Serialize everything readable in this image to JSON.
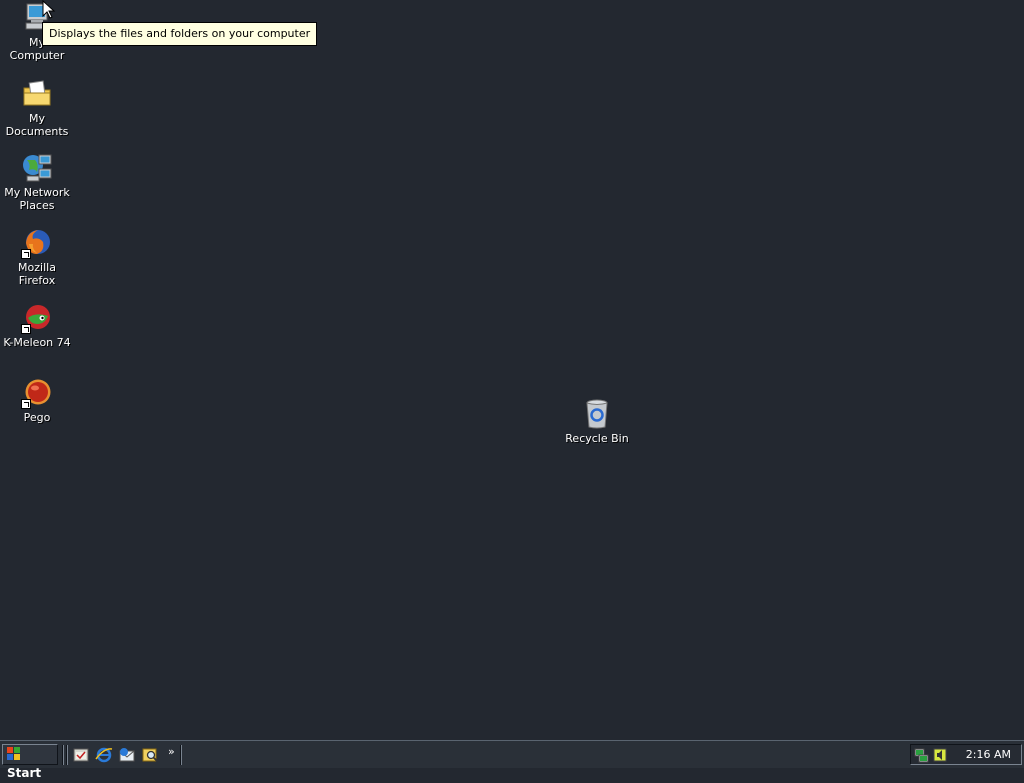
{
  "desktop": {
    "icons": [
      {
        "label": "My Computer",
        "icon": "my-computer-icon"
      },
      {
        "label": "My Documents",
        "icon": "my-documents-icon"
      },
      {
        "label": "My Network Places",
        "icon": "my-network-places-icon"
      },
      {
        "label": "Mozilla Firefox",
        "icon": "firefox-icon",
        "shortcut": true
      },
      {
        "label": "K-Meleon 74",
        "icon": "k-meleon-icon",
        "shortcut": true
      },
      {
        "label": "Pego",
        "icon": "pego-icon",
        "shortcut": true
      },
      {
        "label": "Recycle Bin",
        "icon": "recycle-bin-icon"
      }
    ],
    "background_color": "#232830"
  },
  "tooltip": {
    "text": "Displays the files and folders on your computer"
  },
  "taskbar": {
    "start_label": "Start",
    "quick_launch": [
      {
        "icon": "show-desktop-icon"
      },
      {
        "icon": "internet-explorer-icon"
      },
      {
        "icon": "outlook-express-icon"
      },
      {
        "icon": "search-icon"
      }
    ],
    "more_label": "»",
    "tray_icons": [
      {
        "icon": "network-icon"
      },
      {
        "icon": "volume-icon"
      }
    ],
    "clock": "2:16 AM"
  }
}
